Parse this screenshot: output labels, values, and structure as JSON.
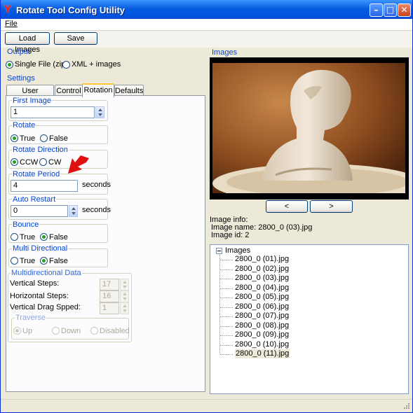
{
  "window": {
    "title": "Rotate Tool Config Utility",
    "icon": "y-logo-icon"
  },
  "menu": {
    "file": "File"
  },
  "toolbar": {
    "load": "Load Images",
    "save": "Save"
  },
  "output": {
    "title": "Output",
    "single": "Single File (zip)",
    "xml": "XML + images",
    "selected": "single"
  },
  "settings": {
    "title": "Settings"
  },
  "tabs": [
    "User Interface",
    "Control",
    "Rotation",
    "Defaults"
  ],
  "selected_tab": "Rotation",
  "rotation": {
    "first_image": {
      "label": "First Image",
      "value": "1"
    },
    "rotate": {
      "label": "Rotate",
      "true": "True",
      "false": "False",
      "selected": "True"
    },
    "direction": {
      "label": "Rotate Direction",
      "ccw": "CCW",
      "cw": "CW",
      "selected": "CCW"
    },
    "period": {
      "label": "Rotate Period",
      "value": "4",
      "unit": "seconds"
    },
    "auto_restart": {
      "label": "Auto Restart",
      "value": "0",
      "unit": "seconds"
    },
    "bounce": {
      "label": "Bounce",
      "true": "True",
      "false": "False",
      "selected": "False"
    },
    "multi": {
      "label": "Multi Directional",
      "true": "True",
      "false": "False",
      "selected": "False"
    },
    "multi_data": {
      "label": "Multidirectional Data",
      "vertical_steps": {
        "label": "Vertical Steps:",
        "value": "17"
      },
      "horizontal_steps": {
        "label": "Horizontal Steps:",
        "value": "16"
      },
      "vertical_drag": {
        "label": "Vertical Drag Spped:",
        "value": "1"
      },
      "traverse": {
        "label": "Traverse",
        "up": "Up",
        "down": "Down",
        "disabled": "Disabled"
      }
    }
  },
  "images": {
    "title": "Images",
    "prev": "<",
    "next": ">",
    "info_title": "Image info:",
    "name_line": "Image name: 2800_0 (03).jpg",
    "id_line": "Image id: 2",
    "tree_root": "Images",
    "files": [
      "2800_0 (01).jpg",
      "2800_0 (02).jpg",
      "2800_0 (03).jpg",
      "2800_0 (04).jpg",
      "2800_0 (05).jpg",
      "2800_0 (06).jpg",
      "2800_0 (07).jpg",
      "2800_0 (08).jpg",
      "2800_0 (09).jpg",
      "2800_0 (10).jpg",
      "2800_0 (11).jpg"
    ],
    "selected_file": "2800_0 (11).jpg"
  },
  "colors": {
    "accent": "#0054e3",
    "group_title": "#0046d5",
    "arrow": "#e01010"
  }
}
